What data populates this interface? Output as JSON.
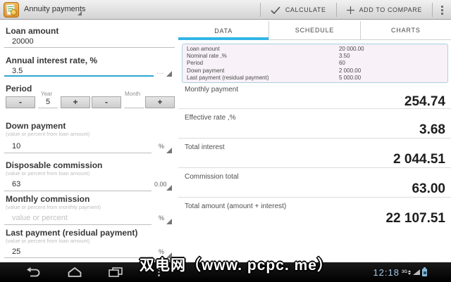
{
  "topbar": {
    "title": "Annuity payments",
    "calculate_label": "CALCULATE",
    "add_to_compare_label": "ADD TO COMPARE"
  },
  "form": {
    "loan_amount": {
      "label": "Loan amount",
      "value": "20000"
    },
    "interest_rate": {
      "label": "Annual interest rate, %",
      "value": "3.5",
      "more": "..."
    },
    "period": {
      "label": "Period",
      "year_label": "Year",
      "year_value": "5",
      "month_label": "Month",
      "month_value": "",
      "minus": "-",
      "plus": "+"
    },
    "down_payment": {
      "label": "Down payment",
      "hint": "(value or percent from loan amount)",
      "value": "10",
      "unit": "%"
    },
    "disposable_commission": {
      "label": "Disposable commission",
      "hint": "(value or percent from loan amount)",
      "value": "63",
      "unit": "0.00"
    },
    "monthly_commission": {
      "label": "Monthly commission",
      "hint": "(value or percent from monthly payment)",
      "placeholder": "value or percent",
      "unit": "%"
    },
    "last_payment": {
      "label": "Last payment (residual payment)",
      "hint": "(value or percent from loan amount)",
      "value": "25",
      "unit": "%"
    }
  },
  "tabs": [
    {
      "label": "DATA",
      "active": true
    },
    {
      "label": "SCHEDULE",
      "active": false
    },
    {
      "label": "CHARTS",
      "active": false
    }
  ],
  "summary": {
    "rows": [
      {
        "label": "Loan amount",
        "value": "20 000.00"
      },
      {
        "label": "Nominal rate ,%",
        "value": "3.50"
      },
      {
        "label": "Period",
        "value": "60"
      },
      {
        "label": "Down payment",
        "value": "2 000.00"
      },
      {
        "label": "Last payment (residual payment)",
        "value": "5 000.00"
      }
    ]
  },
  "results": [
    {
      "label": "Monthly payment",
      "value": "254.74"
    },
    {
      "label": "Effective rate ,%",
      "value": "3.68"
    },
    {
      "label": "Total interest",
      "value": "2 044.51"
    },
    {
      "label": "Commission total",
      "value": "63.00"
    },
    {
      "label": "Total amount (amount + interest)",
      "value": "22 107.51"
    }
  ],
  "watermark": {
    "text": "双电网（www. pcpc. me）"
  },
  "statusbar": {
    "time": "12:18",
    "network": "3G"
  },
  "colors": {
    "accent": "#33b5e5",
    "summary_border": "#a9d1e0",
    "summary_bg": "#f8f1f7"
  }
}
